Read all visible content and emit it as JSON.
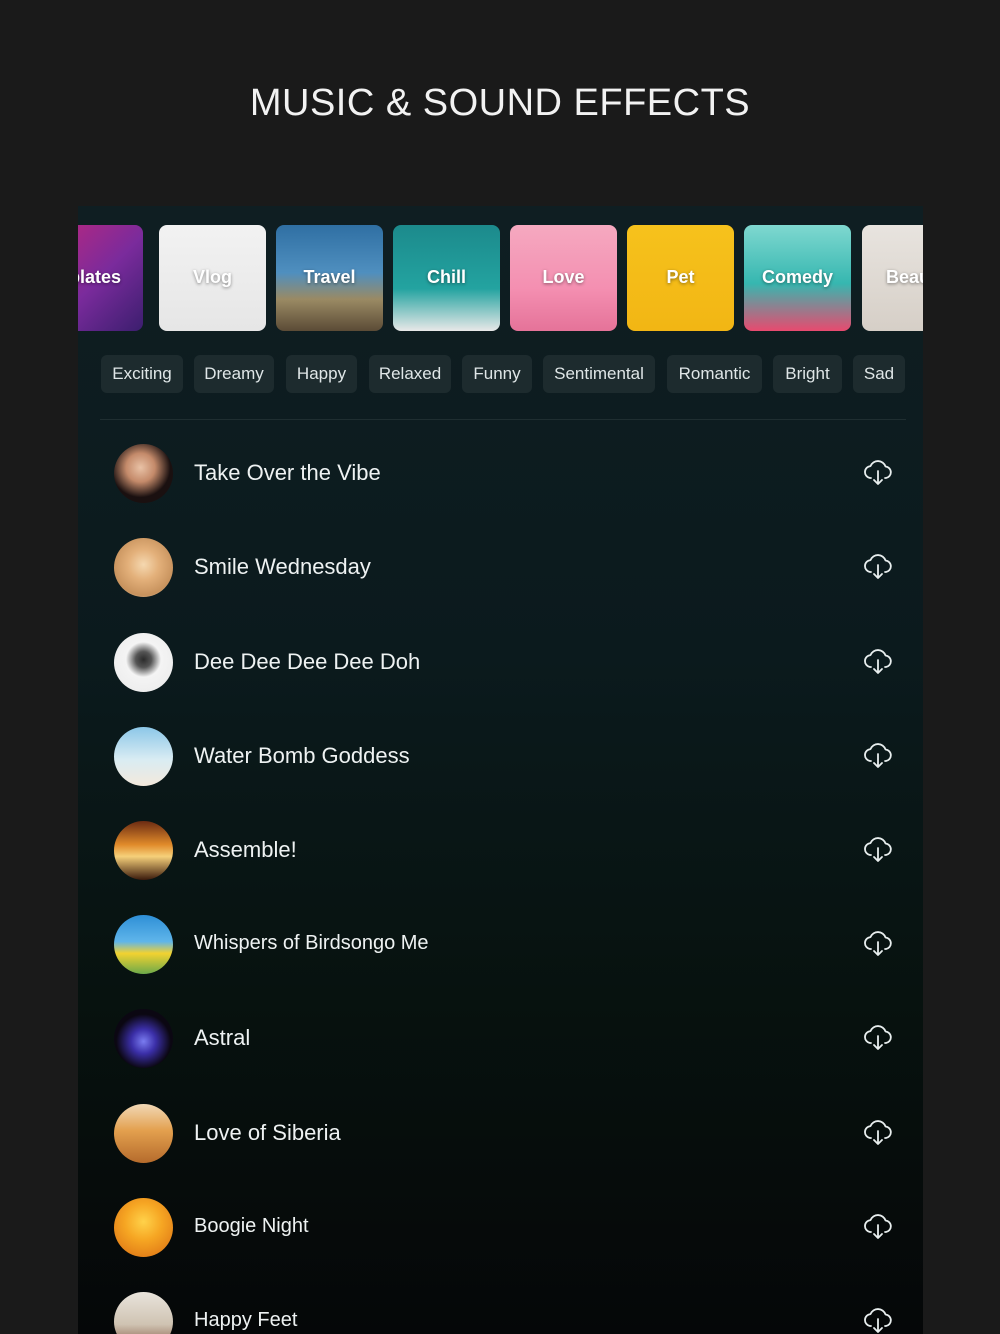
{
  "headline": "MUSIC & SOUND EFFECTS",
  "categories": [
    {
      "label": "nplates",
      "bg": "linear-gradient(135deg,#c2277a 0%,#7a2b9c 55%,#3b1e6e 100%)"
    },
    {
      "label": "Vlog",
      "bg": "linear-gradient(180deg,#f2f2f2 0%,#e6e6e6 100%)"
    },
    {
      "label": "Travel",
      "bg": "linear-gradient(180deg,#2f6fa3 0%,#4f8fbf 45%,#9a8a64 70%,#5b4b36 100%)"
    },
    {
      "label": "Chill",
      "bg": "linear-gradient(180deg,#1c8a8c 0%,#23a3a0 60%,#e8e8e8 100%)"
    },
    {
      "label": "Love",
      "bg": "linear-gradient(180deg,#f5a9c0 0%,#f48fb1 60%,#e57399 100%)"
    },
    {
      "label": "Pet",
      "bg": "linear-gradient(180deg,#f6c21c 0%,#f2b614 100%)"
    },
    {
      "label": "Comedy",
      "bg": "linear-gradient(180deg,#7fd8d0 0%,#36b7b0 55%,#e84a6f 100%)"
    },
    {
      "label": "Beau",
      "bg": "linear-gradient(180deg,#e8e4df 0%,#d6cfc7 100%)"
    }
  ],
  "moods": [
    "Exciting",
    "Dreamy",
    "Happy",
    "Relaxed",
    "Funny",
    "Sentimental",
    "Romantic",
    "Bright",
    "Sad"
  ],
  "tracks": [
    {
      "title": "Take Over the Vibe",
      "avatar": "radial-gradient(circle at 45% 40%,#e9c2a6 0%,#c48a6a 30%,#1a1010 62%)"
    },
    {
      "title": "Smile Wednesday",
      "avatar": "radial-gradient(circle at 50% 45%,#f5d8b0 0%,#e3b07a 35%,#c7925d 70%,#efe6da 100%)"
    },
    {
      "title": "Dee Dee Dee Dee Doh",
      "avatar": "radial-gradient(circle at 50% 45%,#2b2b2b 0%,#555 18%,#f4f4f4 40%,#e9e9e9 100%)"
    },
    {
      "title": "Water Bomb Goddess",
      "avatar": "linear-gradient(180deg,#8cc7e8 0%,#d9ecf3 55%,#f3e9dc 100%)"
    },
    {
      "title": "Assemble!",
      "avatar": "linear-gradient(180deg,#6b2b12 0%,#e08a2a 40%,#f6d07a 60%,#3a1a0c 100%)"
    },
    {
      "title": "Whispers of Birdsongo Me",
      "avatar": "linear-gradient(180deg,#2e8fd6 0%,#5fb5ea 45%,#f2d230 65%,#6ca94a 100%)"
    },
    {
      "title": "Astral",
      "avatar": "radial-gradient(circle at 50% 55%,#7a7cf0 0%,#3b2fa8 28%,#0b0712 62%)"
    },
    {
      "title": "Love of Siberia",
      "avatar": "linear-gradient(180deg,#f1d8b6 0%,#e3a04e 45%,#b56b2c 100%)"
    },
    {
      "title": "Boogie Night",
      "avatar": "radial-gradient(circle at 50% 40%,#ffd24a 0%,#f6a623 40%,#d86a12 100%)"
    },
    {
      "title": "Happy Feet",
      "avatar": "linear-gradient(180deg,#e9e4dc 0%,#cfc3b2 55%,#7a4b34 100%)"
    }
  ]
}
